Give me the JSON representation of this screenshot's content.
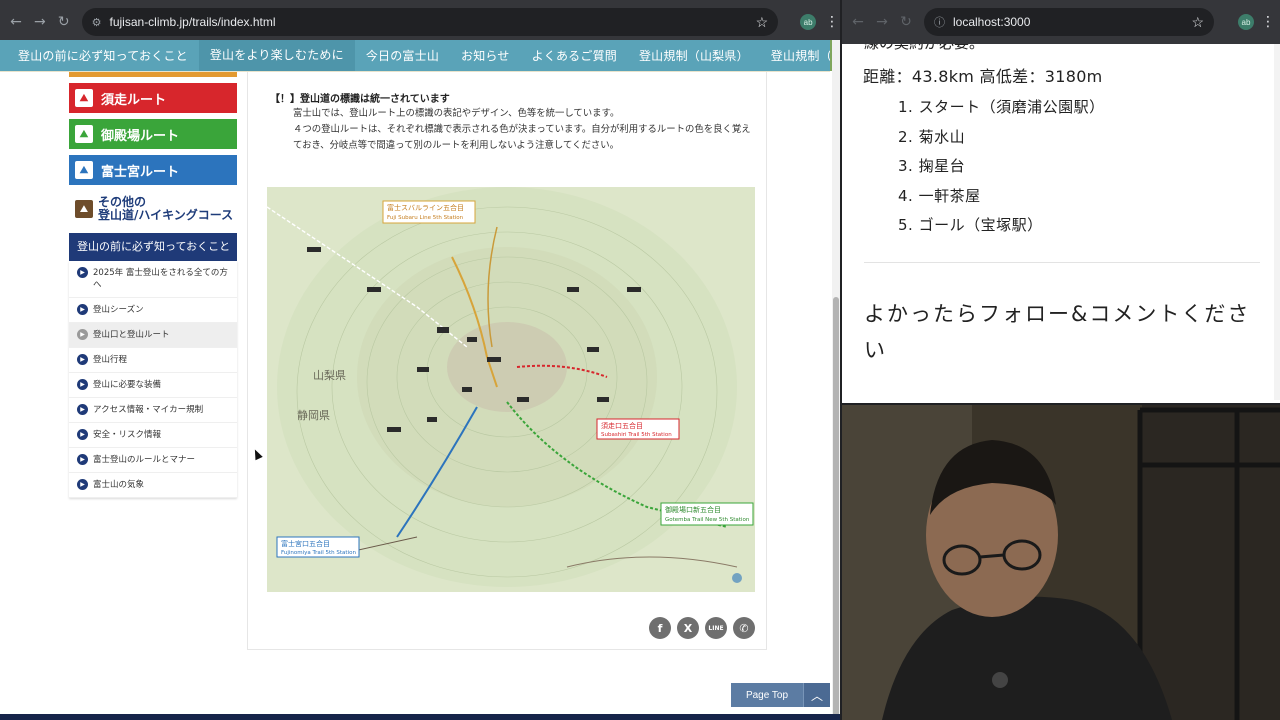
{
  "left_browser": {
    "url": "fujisan-climb.jp/trails/index.html",
    "site_nav": [
      {
        "label": "登山の前に必ず知っておくこと"
      },
      {
        "label": "登山をより楽しむために"
      },
      {
        "label": "今日の富士山"
      },
      {
        "label": "お知らせ"
      },
      {
        "label": "よくあるご質問"
      },
      {
        "label": "登山規制（山梨県）"
      },
      {
        "label": "登山規制（静岡県）"
      }
    ],
    "routes": [
      {
        "label": "須走ルート",
        "color": "#d7262c"
      },
      {
        "label": "御殿場ルート",
        "color": "#3aa53a"
      },
      {
        "label": "富士宮ルート",
        "color": "#2c74bd"
      }
    ],
    "other_route": {
      "line1": "その他の",
      "line2": "登山道/ハイキングコース"
    },
    "side_heading": "登山の前に必ず知っておくこと",
    "side_items": [
      "2025年 富士登山をされる全ての方へ",
      "登山シーズン",
      "登山口と登山ルート",
      "登山行程",
      "登山に必要な装備",
      "アクセス情報・マイカー規制",
      "安全・リスク情報",
      "富士登山のルールとマナー",
      "富士山の気象"
    ],
    "notice_title": "【！】登山道の標識は統一されています",
    "notice_p1": "富士山では、登山ルート上の標識の表記やデザイン、色等を統一しています。",
    "notice_p2": "４つの登山ルートは、それぞれ標識で表示される色が決まっています。自分が利用するルートの色を良く覚えておき、分岐点等で間違って別のルートを利用しないよう注意してください。",
    "map_labels": {
      "subaru_station_jp": "富士スバルライン五合目",
      "subaru_station_en": "Fuji Subaru Line 5th Station",
      "subashiri_station_jp": "須走口五合目",
      "subashiri_station_en": "Subashiri Trail 5th Station",
      "gotemba_station_jp": "御殿場口新五合目",
      "gotemba_station_en": "Gotemba Trail New 5th Station",
      "fujinomiya_station_jp": "富士宮口五合目",
      "fujinomiya_station_en": "Fujinomiya Trail 5th Station",
      "yamanashi": "山梨県",
      "shizuoka": "静岡県"
    },
    "page_top": "Page Top"
  },
  "right_browser": {
    "url": "localhost:3000",
    "cut_line": "線の契約が必要。",
    "distance": "距離：43.8km 高低差：3180m",
    "steps": [
      "1. スタート（須磨浦公園駅）",
      "2. 菊水山",
      "3. 掬星台",
      "4. 一軒茶屋",
      "5. ゴール（宝塚駅）"
    ],
    "follow_text": "よかったらフォロー&コメントください"
  },
  "profile_initials": "ab"
}
